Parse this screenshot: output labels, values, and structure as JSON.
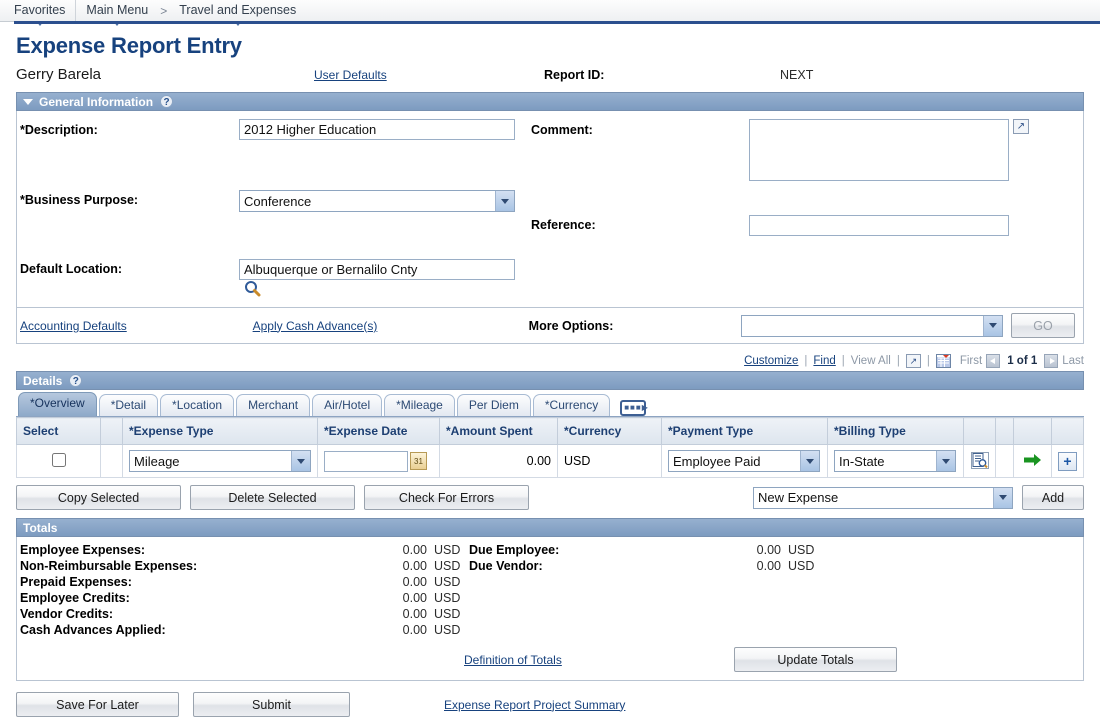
{
  "nav": {
    "favorites": "Favorites",
    "main_menu": "Main Menu",
    "separator": ">",
    "travel_expenses": "Travel and Expenses"
  },
  "header": {
    "page_title": "Expense Report Entry",
    "employee_name": "Gerry Barela",
    "user_defaults_link": "User Defaults",
    "report_id_label": "Report ID:",
    "report_id_value": "NEXT"
  },
  "general_information": {
    "section_title": "General Information",
    "help_icon": "?",
    "description_label": "*Description:",
    "description_value": "2012 Higher Education",
    "business_purpose_label": "*Business Purpose:",
    "business_purpose_value": "Conference",
    "default_location_label": "Default Location:",
    "default_location_value": "Albuquerque or Bernalilo Cnty",
    "comment_label": "Comment:",
    "comment_value": "",
    "reference_label": "Reference:",
    "reference_value": "",
    "lookup_icon": "search-icon",
    "expand_icon": "expand-icon"
  },
  "defaults_row": {
    "accounting_defaults_link": "Accounting Defaults",
    "apply_cash_advance_link": "Apply Cash Advance(s)",
    "more_options_label": "More Options:",
    "more_options_value": "",
    "go_button": "GO"
  },
  "details": {
    "section_title": "Details",
    "help_icon": "?",
    "toolbar": {
      "customize": "Customize",
      "find": "Find",
      "view_all": "View All",
      "expand_icon": "expand-icon",
      "excel_icon": "download-excel-icon",
      "first": "First",
      "page_indicator": "1 of 1",
      "last": "Last"
    },
    "tabs": [
      {
        "label": "*Overview",
        "active": true
      },
      {
        "label": "*Detail",
        "active": false
      },
      {
        "label": "*Location",
        "active": false
      },
      {
        "label": "Merchant",
        "active": false
      },
      {
        "label": "Air/Hotel",
        "active": false
      },
      {
        "label": "*Mileage",
        "active": false
      },
      {
        "label": "Per Diem",
        "active": false
      },
      {
        "label": "*Currency",
        "active": false
      }
    ],
    "columns": [
      "Select",
      "",
      "*Expense Type",
      "*Expense Date",
      "*Amount Spent",
      "*Currency",
      "*Payment Type",
      "*Billing Type",
      "",
      "",
      "",
      ""
    ],
    "rows": [
      {
        "selected": false,
        "expense_type": "Mileage",
        "expense_date": "",
        "amount_spent": "0.00",
        "currency": "USD",
        "payment_type": "Employee Paid",
        "billing_type": "In-State"
      }
    ],
    "actions": {
      "copy_selected": "Copy Selected",
      "delete_selected": "Delete Selected",
      "check_for_errors": "Check For Errors",
      "new_expense_value": "New Expense",
      "add_button": "Add"
    }
  },
  "totals": {
    "section_title": "Totals",
    "left_items": [
      {
        "label": "Employee Expenses:",
        "value": "0.00",
        "currency": "USD"
      },
      {
        "label": "Non-Reimbursable Expenses:",
        "value": "0.00",
        "currency": "USD"
      },
      {
        "label": "Prepaid Expenses:",
        "value": "0.00",
        "currency": "USD"
      },
      {
        "label": "Employee Credits:",
        "value": "0.00",
        "currency": "USD"
      },
      {
        "label": "Vendor Credits:",
        "value": "0.00",
        "currency": "USD"
      },
      {
        "label": "Cash Advances Applied:",
        "value": "0.00",
        "currency": "USD"
      }
    ],
    "right_items": [
      {
        "label": "Due Employee:",
        "value": "0.00",
        "currency": "USD"
      },
      {
        "label": "Due Vendor:",
        "value": "0.00",
        "currency": "USD"
      }
    ],
    "definition_link": "Definition of Totals",
    "update_totals_button": "Update Totals"
  },
  "footer": {
    "save_for_later": "Save For Later",
    "submit": "Submit",
    "project_summary_link": "Expense Report Project Summary"
  }
}
